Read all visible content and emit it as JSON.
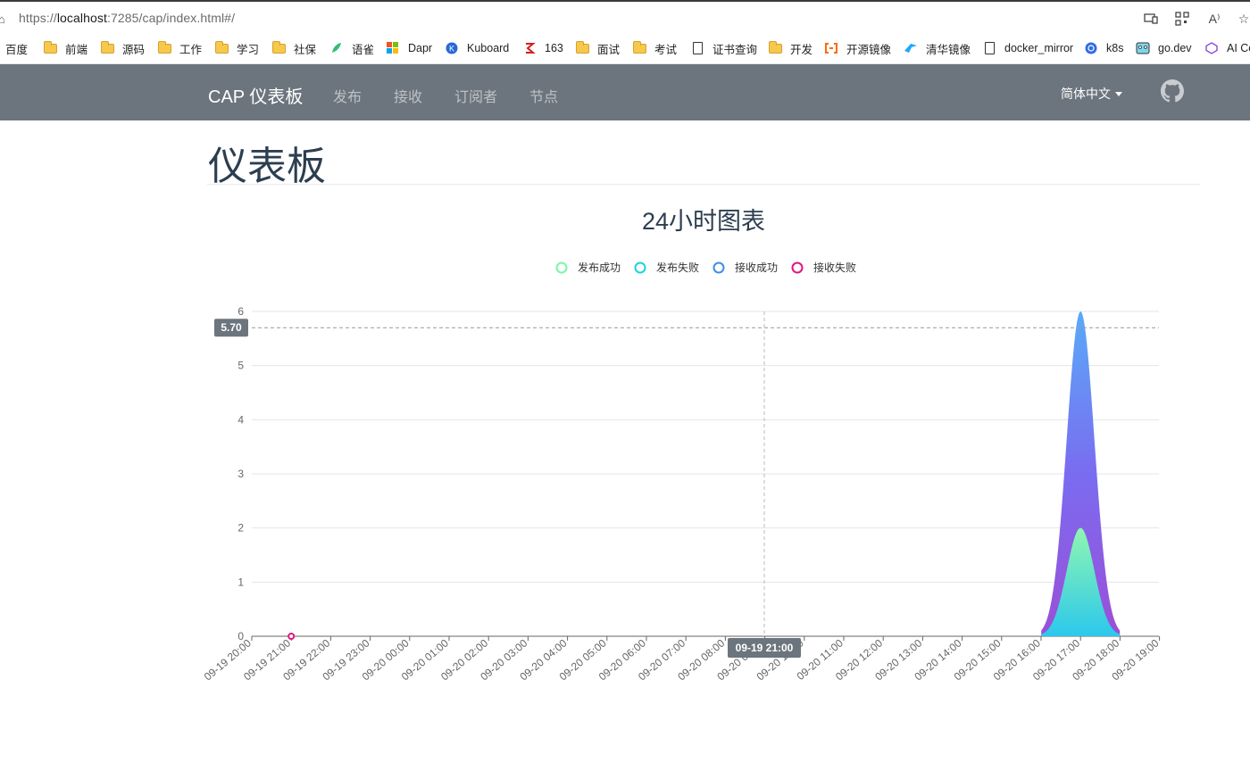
{
  "browser": {
    "url_prefix": "https://",
    "url_host": "localhost",
    "url_rest": ":7285/cap/index.html#/",
    "read_aloud_label": "A⁾"
  },
  "bookmarks": [
    {
      "label": "百度",
      "icon": "none"
    },
    {
      "label": "前端",
      "icon": "folder"
    },
    {
      "label": "源码",
      "icon": "folder"
    },
    {
      "label": "工作",
      "icon": "folder"
    },
    {
      "label": "学习",
      "icon": "folder"
    },
    {
      "label": "社保",
      "icon": "folder"
    },
    {
      "label": "语雀",
      "icon": "yuque-icon"
    },
    {
      "label": "Dapr",
      "icon": "microsoft-icon"
    },
    {
      "label": "Kuboard",
      "icon": "kuboard-icon"
    },
    {
      "label": "163",
      "icon": "netease-icon"
    },
    {
      "label": "面试",
      "icon": "folder"
    },
    {
      "label": "考试",
      "icon": "folder"
    },
    {
      "label": "证书查询",
      "icon": "document"
    },
    {
      "label": "开发",
      "icon": "folder"
    },
    {
      "label": "开源镜像",
      "icon": "aliyun-icon"
    },
    {
      "label": "清华镜像",
      "icon": "tsinghua-icon"
    },
    {
      "label": "docker_mirror",
      "icon": "document"
    },
    {
      "label": "k8s",
      "icon": "kubernetes-icon"
    },
    {
      "label": "go.dev",
      "icon": "gopher-icon"
    },
    {
      "label": "AI Co",
      "icon": "ai-icon"
    }
  ],
  "navbar": {
    "brand": "CAP 仪表板",
    "links": [
      "发布",
      "接收",
      "订阅者",
      "节点"
    ],
    "language": "简体中文",
    "github_icon": "github-icon",
    "background": "#6c757d"
  },
  "page": {
    "title": "仪表板"
  },
  "chart_data": {
    "type": "area",
    "title": "24小时图表",
    "legend_position": "top-center",
    "grid": true,
    "ylim": [
      0,
      6
    ],
    "y_ticks": [
      "0",
      "1",
      "2",
      "3",
      "4",
      "5",
      "6"
    ],
    "x_categories": [
      "09-19 20:00",
      "09-19 21:00",
      "09-19 22:00",
      "09-19 23:00",
      "09-20 00:00",
      "09-20 01:00",
      "09-20 02:00",
      "09-20 03:00",
      "09-20 04:00",
      "09-20 05:00",
      "09-20 06:00",
      "09-20 07:00",
      "09-20 08:00",
      "09-20 09:00",
      "09-20 10:00",
      "09-20 11:00",
      "09-20 12:00",
      "09-20 13:00",
      "09-20 14:00",
      "09-20 15:00",
      "09-20 16:00",
      "09-20 17:00",
      "09-20 18:00",
      "09-20 19:00"
    ],
    "series": [
      {
        "name": "发布成功",
        "color": "#7bf5a6",
        "values": [
          0,
          0,
          0,
          0,
          0,
          0,
          0,
          0,
          0,
          0,
          0,
          0,
          0,
          0,
          0,
          0,
          0,
          0,
          0,
          0,
          0,
          2,
          0,
          0
        ]
      },
      {
        "name": "发布失败",
        "color": "#19d4e0",
        "values": [
          0,
          0,
          0,
          0,
          0,
          0,
          0,
          0,
          0,
          0,
          0,
          0,
          0,
          0,
          0,
          0,
          0,
          0,
          0,
          0,
          0,
          0,
          0,
          0
        ]
      },
      {
        "name": "接收成功",
        "color": "#3a8fe8",
        "values": [
          0,
          0,
          0,
          0,
          0,
          0,
          0,
          0,
          0,
          0,
          0,
          0,
          0,
          0,
          0,
          0,
          0,
          0,
          0,
          0,
          0,
          6,
          0,
          0
        ]
      },
      {
        "name": "接收失败",
        "color": "#e0157f",
        "values": [
          0,
          0,
          0,
          0,
          0,
          0,
          0,
          0,
          0,
          0,
          0,
          0,
          0,
          0,
          0,
          0,
          0,
          0,
          0,
          0,
          0,
          0,
          0,
          0
        ]
      }
    ],
    "crosshair": {
      "y_value": 5.7,
      "y_label": "5.70",
      "x_label": "09-19 21:00"
    }
  }
}
